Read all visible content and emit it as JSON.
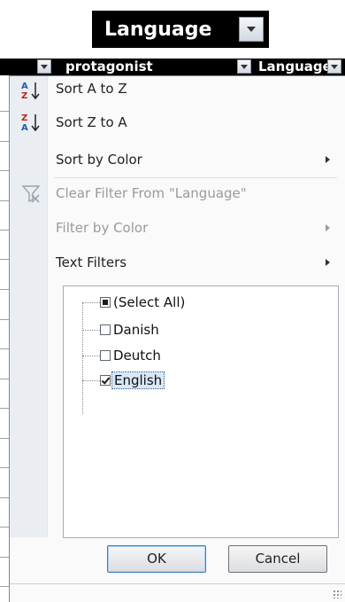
{
  "top_header": {
    "label": "Language"
  },
  "header_row": {
    "col1": "protagonist",
    "col2": "Language"
  },
  "menu": {
    "items": [
      {
        "label": "Sort A to Z",
        "disabled": false,
        "submenu": false,
        "icon": "sort-asc-icon"
      },
      {
        "label": "Sort Z to A",
        "disabled": false,
        "submenu": false,
        "icon": "sort-desc-icon"
      },
      {
        "label": "Sort by Color",
        "disabled": false,
        "submenu": true,
        "icon": ""
      },
      {
        "label": "Clear Filter From \"Language\"",
        "disabled": true,
        "submenu": false,
        "icon": "clear-filter-icon"
      },
      {
        "label": "Filter by Color",
        "disabled": true,
        "submenu": true,
        "icon": ""
      },
      {
        "label": "Text Filters",
        "disabled": false,
        "submenu": true,
        "icon": ""
      }
    ]
  },
  "filter_list": {
    "items": [
      {
        "label": "(Select All)",
        "state": "indeterminate"
      },
      {
        "label": "Danish",
        "state": "unchecked"
      },
      {
        "label": "Deutch",
        "state": "unchecked"
      },
      {
        "label": "English",
        "state": "checked"
      }
    ]
  },
  "buttons": {
    "ok": "OK",
    "cancel": "Cancel"
  }
}
